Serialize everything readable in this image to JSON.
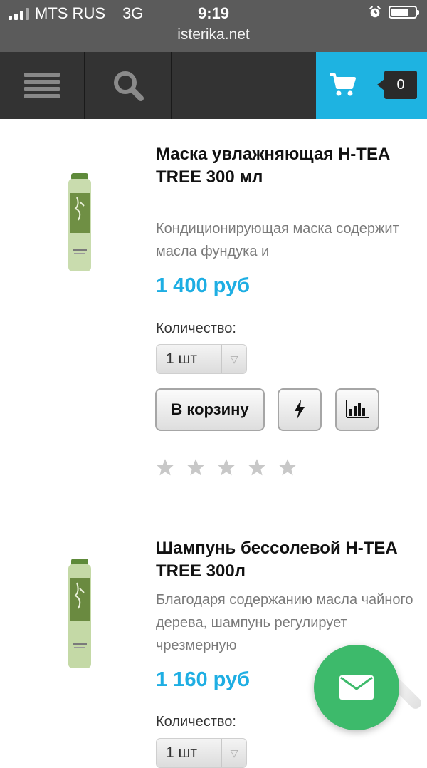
{
  "status_bar": {
    "carrier": "MTS RUS",
    "network": "3G",
    "time": "9:19",
    "url": "isterika.net"
  },
  "nav": {
    "menu_icon": "hamburger-icon",
    "search_icon": "search-icon",
    "cart_icon": "cart-icon",
    "cart_count": "0",
    "accent_color": "#1eb3e1"
  },
  "products": [
    {
      "title": "Маска увлажняющая H-TEA TREE 300 мл",
      "description": "Кондиционирующая маска содержит масла фундука и",
      "price": "1 400 руб",
      "quantity_label": "Количество:",
      "quantity_value": "1 шт",
      "add_to_cart_label": "В корзину",
      "quick_buy_icon": "lightning-icon",
      "compare_icon": "bar-chart-icon",
      "rating": 0,
      "rating_max": 5
    },
    {
      "title": "Шампунь бессолевой H-TEA TREE 300л",
      "description": "Благодаря содержанию масла чайного дерева, шампунь регулирует чрезмерную",
      "price": "1 160 руб",
      "quantity_label": "Количество:",
      "quantity_value": "1 шт"
    }
  ],
  "fab": {
    "icon": "mail-icon",
    "color": "#3dba6b"
  }
}
